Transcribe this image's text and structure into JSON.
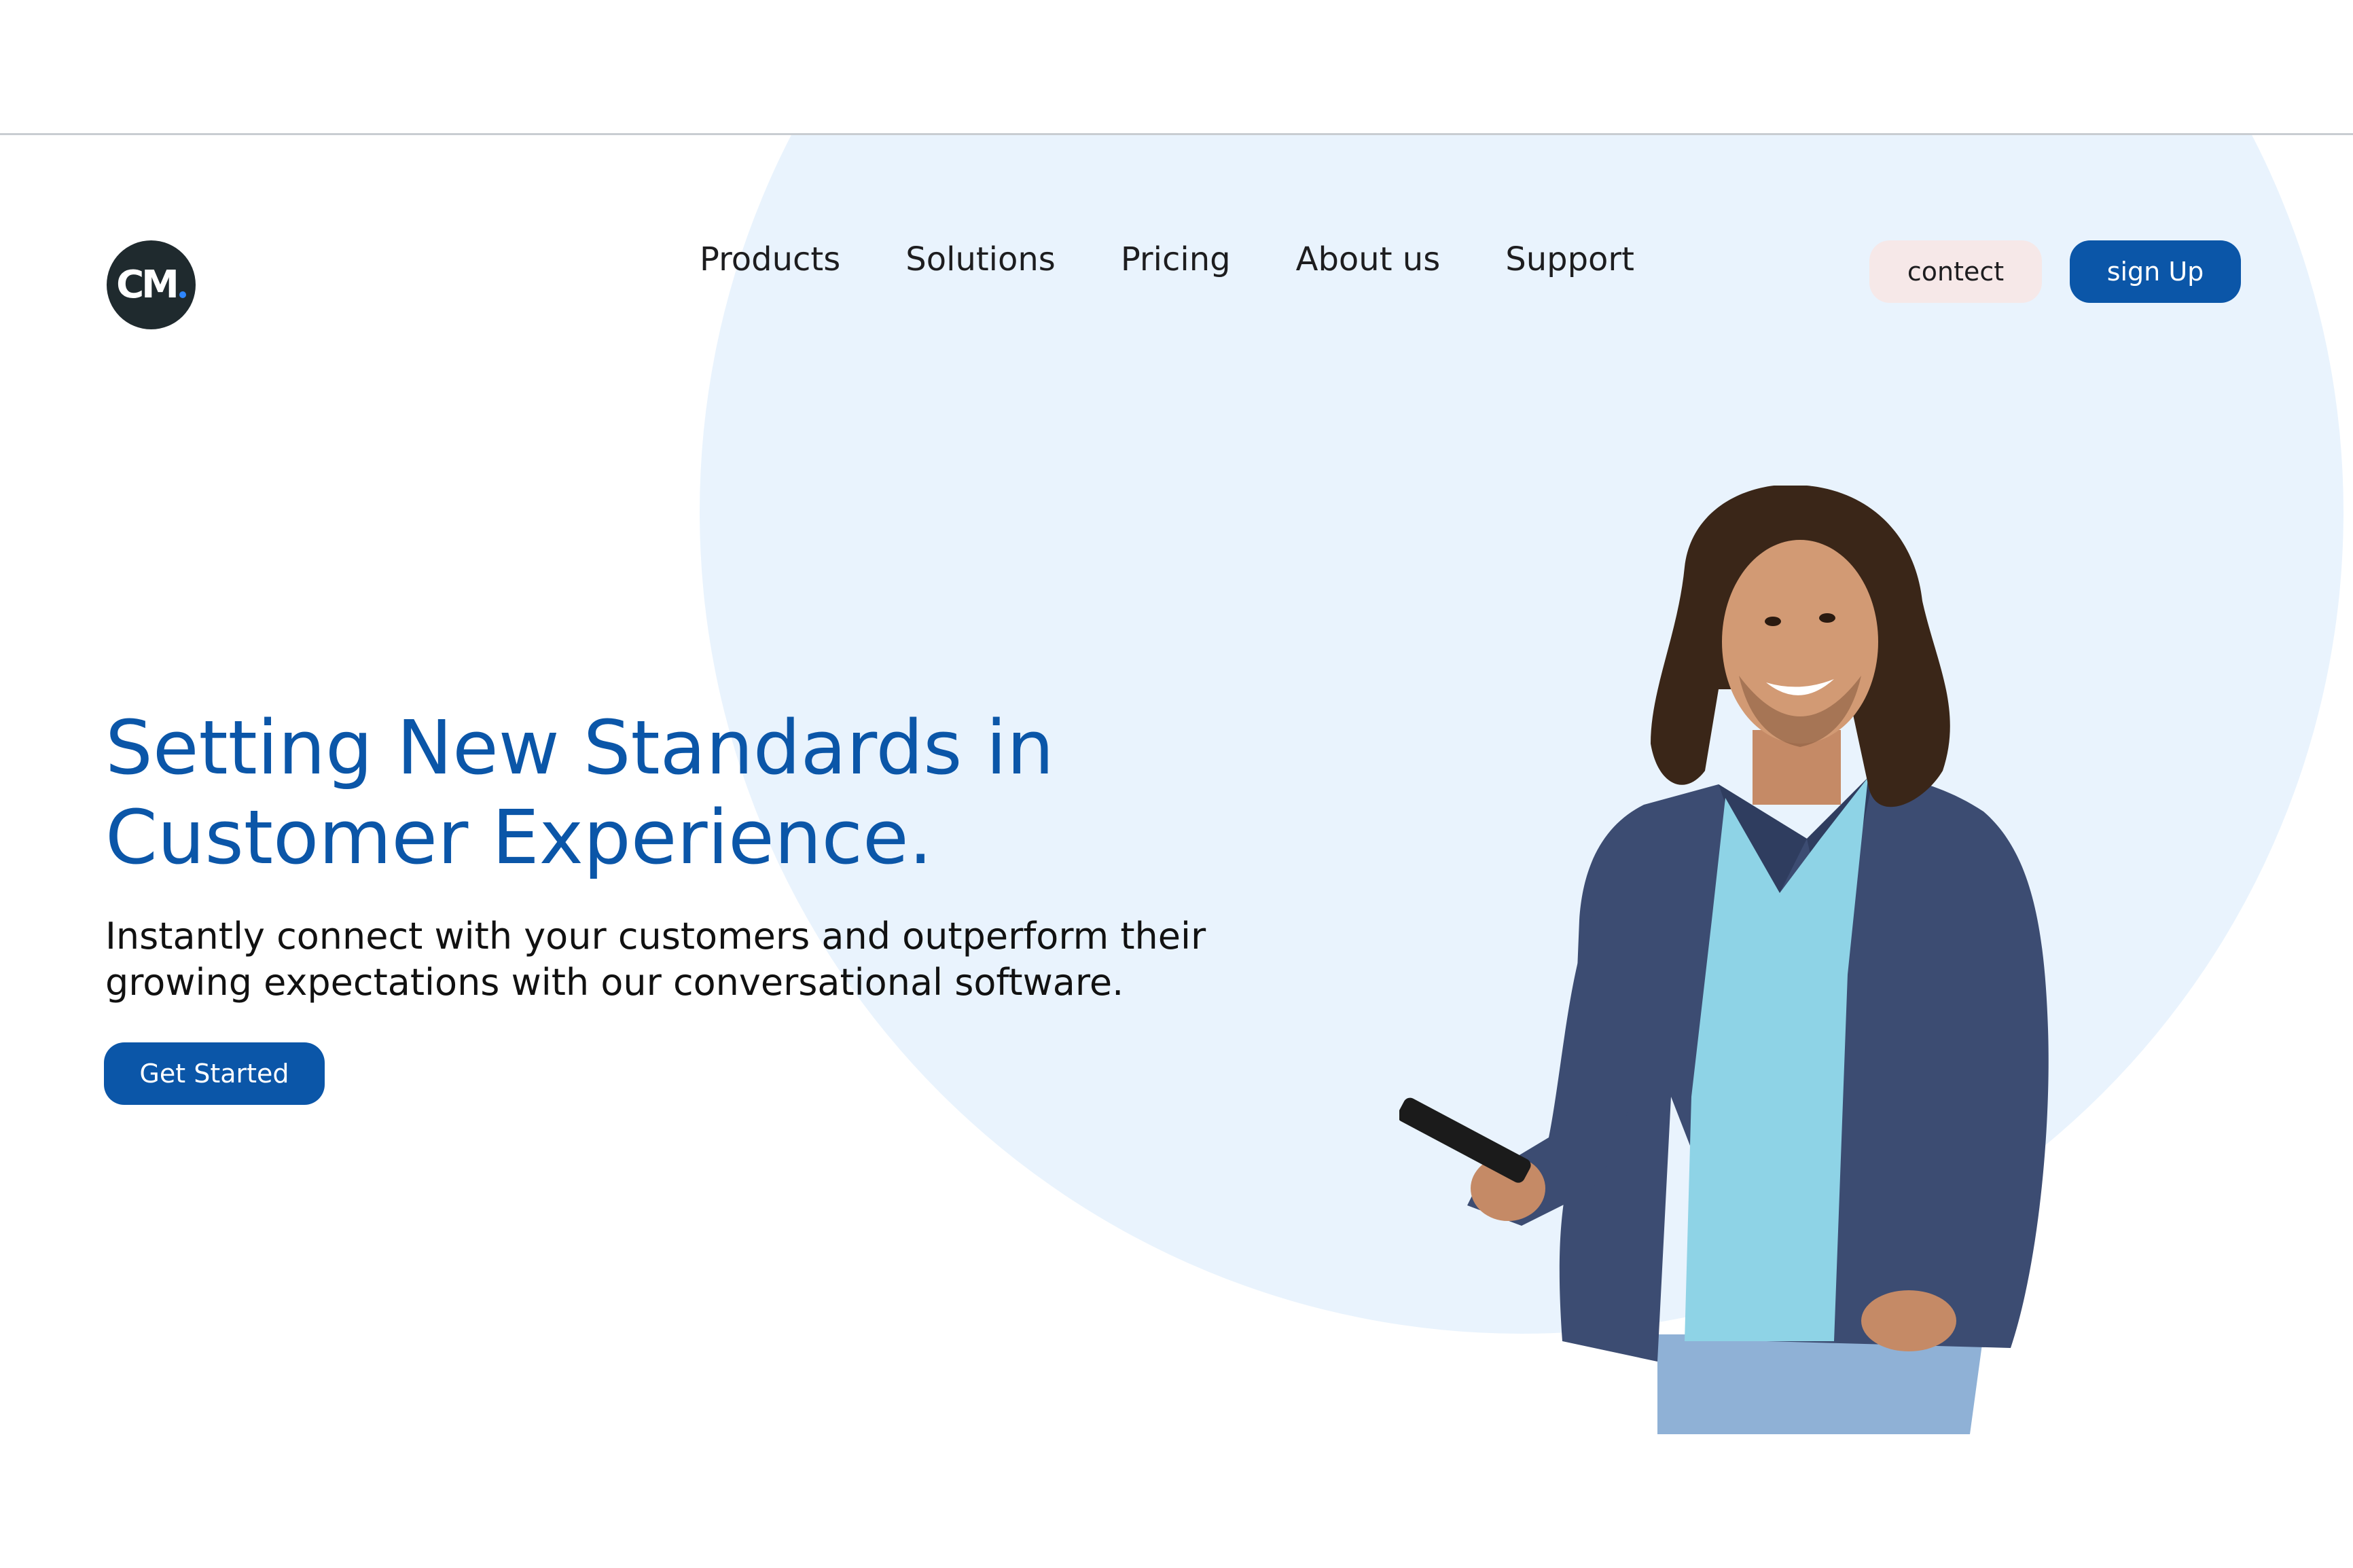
{
  "brand": {
    "logo_text": "CM",
    "logo_color": "#1f2a2e",
    "accent": "#0b56a8",
    "hero_background": "#e9f3fd"
  },
  "nav": {
    "items": [
      {
        "label": "Products"
      },
      {
        "label": "Solutions"
      },
      {
        "label": "Pricing"
      },
      {
        "label": "About us"
      },
      {
        "label": "Support"
      }
    ]
  },
  "header_actions": {
    "contact_label": "contect",
    "signup_label": "sign Up"
  },
  "hero": {
    "headline": "Setting New Standards in Customer Experience.",
    "subtext": "Instantly connect with your customers and outperform their growing expectations with our conversational software.",
    "cta_label": "Get Started",
    "image_icon": "person-with-phone-illustration"
  }
}
